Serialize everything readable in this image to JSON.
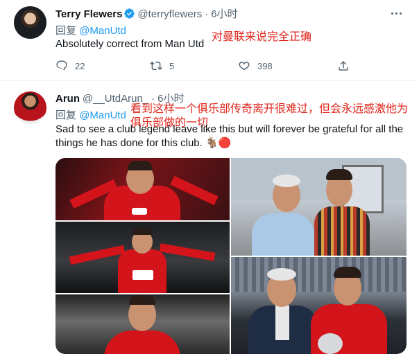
{
  "tweets": [
    {
      "name": "Terry Flewers",
      "handle": "@terryflewers",
      "separator": "·",
      "time": "6小时",
      "reply_prefix": "回复",
      "reply_to": "@ManUtd",
      "text": "Absolutely correct from Man Utd",
      "annotation": "对曼联来说完全正确",
      "stats": {
        "replies": "22",
        "retweets": "5",
        "likes": "398"
      }
    },
    {
      "name": "Arun",
      "handle": "@__UtdArun_",
      "separator": "·",
      "time": "6小时",
      "reply_prefix": "回复",
      "reply_to": "@ManUtd",
      "text_line1": "Sad to see a club legend leave like this but will forever be grateful for all the",
      "text_line2": "things he has done for this club. 🐐🔴",
      "annotation_line1": "看到这样一个俱乐部传奇离开很难过，但会永远感激他为",
      "annotation_line2": "俱乐部做的一切",
      "media_alt": "photo collage"
    }
  ],
  "colors": {
    "accent": "#1d9bf0",
    "annotation": "#e0261c",
    "muted": "#536471",
    "verified": "#1d9bf0"
  }
}
